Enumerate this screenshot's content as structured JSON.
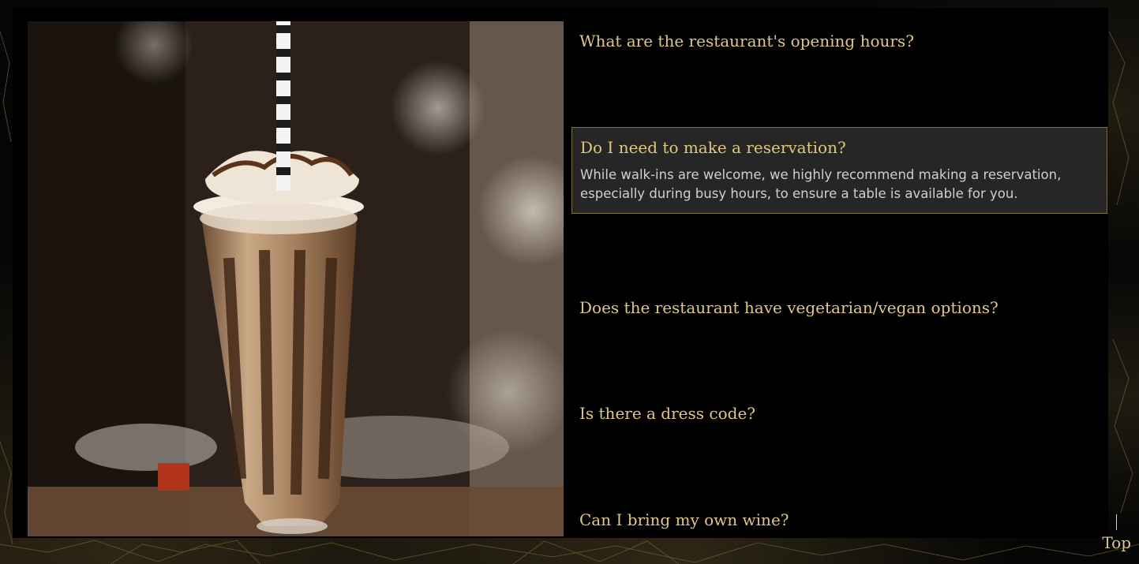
{
  "faq": {
    "items": [
      {
        "question": "What are the restaurant's opening hours?",
        "answer": "",
        "open": false
      },
      {
        "question": "Do I need to make a reservation?",
        "answer": "While walk-ins are welcome, we highly recommend making a reservation, especially during busy hours, to ensure a table is available for you.",
        "open": true
      },
      {
        "question": "Does the restaurant have vegetarian/vegan options?",
        "answer": "",
        "open": false
      },
      {
        "question": "Is there a dress code?",
        "answer": "",
        "open": false
      },
      {
        "question": "Can I bring my own wine?",
        "answer": "",
        "open": false
      }
    ]
  },
  "top_link": {
    "label": "Top"
  },
  "image": {
    "subject": "milkshake-photo"
  },
  "colors": {
    "accent": "#e2c87c",
    "background": "#000000",
    "open_panel": "#262626",
    "open_border": "#7c7040"
  }
}
